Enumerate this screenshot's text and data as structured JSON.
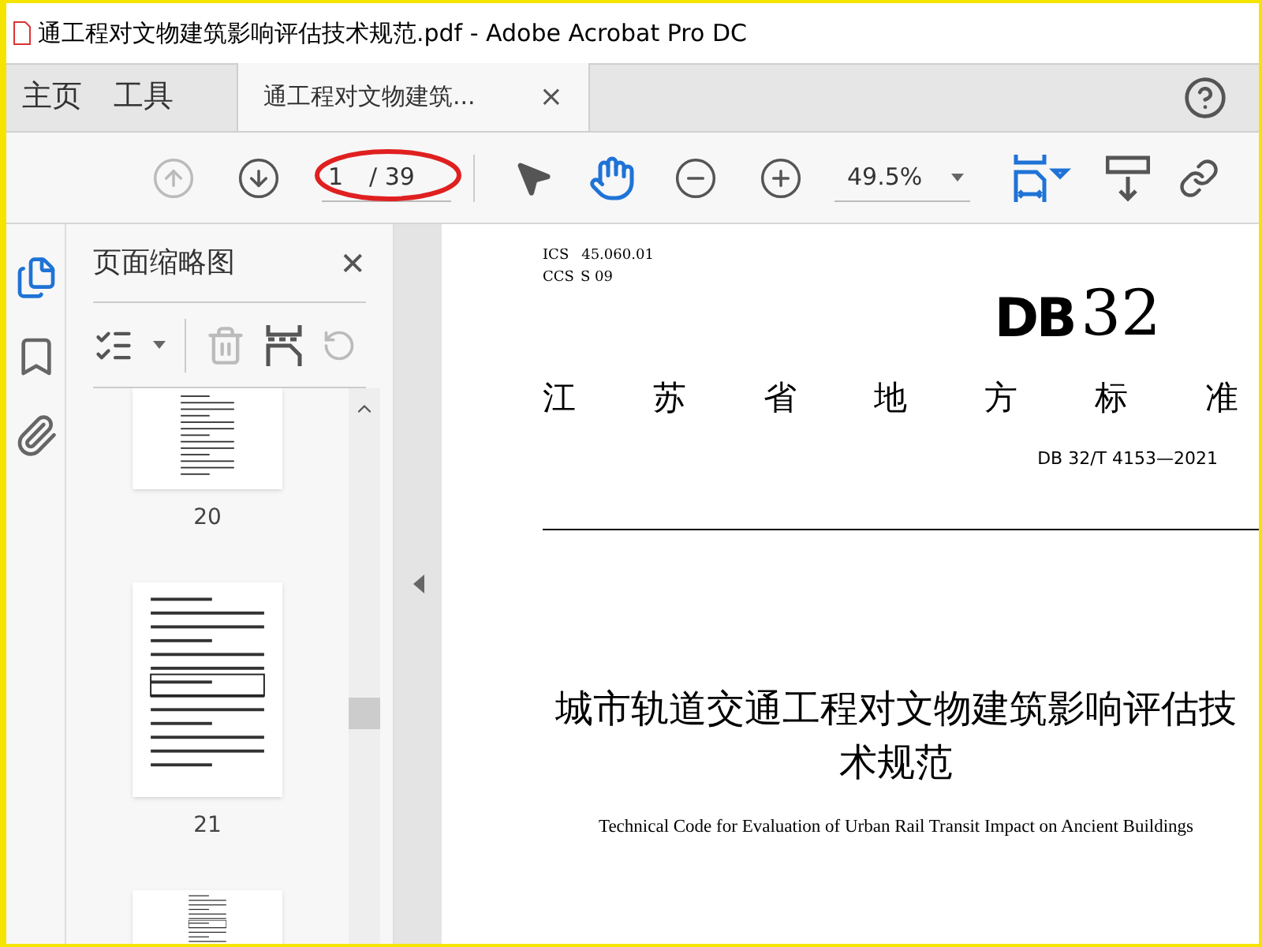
{
  "window": {
    "title": "通工程对文物建筑影响评估技术规范.pdf - Adobe Acrobat Pro DC"
  },
  "tabs": [
    {
      "label": "主页",
      "selected": false
    },
    {
      "label": "工具",
      "selected": false
    },
    {
      "label": "通工程对文物建筑...",
      "selected": true,
      "close": "×"
    }
  ],
  "toolbar": {
    "page_input": "1",
    "page_total": "/ 39",
    "zoom": "49.5%",
    "annotation": true
  },
  "side_rail": [
    {
      "kind": "pages",
      "selected": true
    },
    {
      "kind": "bookmarks",
      "selected": false
    },
    {
      "kind": "attachments",
      "selected": false
    }
  ],
  "thumbnails_panel": {
    "title": "页面缩略图",
    "close": "✕",
    "pages": [
      {
        "label": "20",
        "selected": false,
        "kind": "cut_top"
      },
      {
        "label": "21",
        "selected": false,
        "kind": "full"
      },
      {
        "selected": false,
        "kind": "cut_bottom"
      }
    ]
  },
  "document": {
    "ics": "ICS",
    "ics_code": "45.060.01",
    "ccs": "CCS",
    "ccs_code": "S 09",
    "logo_letters": "DB",
    "logo_number": "32",
    "heading": [
      "江",
      "苏",
      "省",
      "地",
      "方",
      "标",
      "准"
    ],
    "code": "DB 32/T 4153—2021",
    "title": "城市轨道交通工程对文物建筑影响评估技术规范",
    "subtitle": "Technical Code for Evaluation of Urban Rail Transit Impact on Ancient Buildings"
  }
}
